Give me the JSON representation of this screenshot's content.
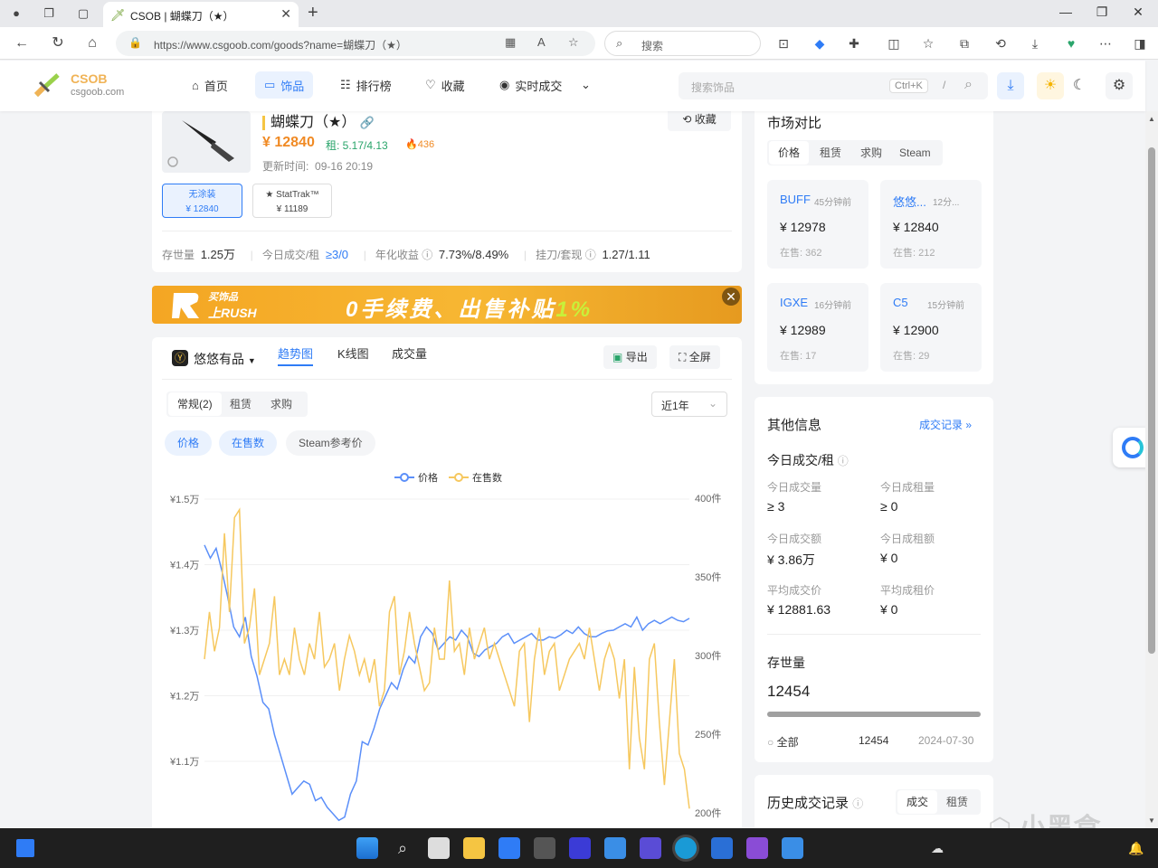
{
  "browser": {
    "tab_title": "CSOB | 蝴蝶刀（★）",
    "url": "https://www.csgoob.com/goods?name=蝴蝶刀（★）",
    "search_placeholder": "搜索"
  },
  "header": {
    "brand": "CSOB",
    "brand_sub": "csgoob.com",
    "nav": [
      {
        "label": "首页",
        "icon": "home-icon"
      },
      {
        "label": "饰品",
        "icon": "box-icon"
      },
      {
        "label": "排行榜",
        "icon": "ranking-icon"
      },
      {
        "label": "收藏",
        "icon": "heart-icon"
      },
      {
        "label": "实时成交",
        "icon": "live-icon"
      }
    ],
    "search_placeholder": "搜索饰品",
    "shortcut": "Ctrl+K",
    "slash": "/"
  },
  "item": {
    "title": "蝴蝶刀（★）",
    "price": "¥ 12840",
    "rent": "租: 5.17/4.13",
    "hot": "436",
    "updated_label": "更新时间:",
    "updated": "09-16 20:19",
    "fav": "收藏",
    "wear": [
      {
        "name": "无涂装",
        "price": "¥ 12840"
      },
      {
        "name": "★ StatTrak™",
        "price": "¥ 11189"
      }
    ],
    "stats": {
      "stock_label": "存世量",
      "stock": "1.25万",
      "today_label": "今日成交/租",
      "today": "≥3/0",
      "yield_label": "年化收益",
      "yield": "7.73%/8.49%",
      "ratio_label": "挂刀/套现",
      "ratio": "1.27/1.11"
    }
  },
  "banner": {
    "line1": "买饰品",
    "line2": "上RUSH",
    "main": "0手续费、出售补贴",
    "pct": "1%"
  },
  "chart_panel": {
    "platform": "悠悠有品",
    "tabs": [
      "趋势图",
      "K线图",
      "成交量"
    ],
    "export": "导出",
    "fullscreen": "全屏",
    "subtabs": [
      "常规(2)",
      "租赁",
      "求购"
    ],
    "range": "近1年",
    "filters": [
      "价格",
      "在售数",
      "Steam参考价"
    ]
  },
  "chart_data": {
    "type": "line",
    "legend": [
      "价格",
      "在售数"
    ],
    "legend_position": "top-center",
    "y_left_ticks": [
      "¥1.5万",
      "¥1.4万",
      "¥1.3万",
      "¥1.2万",
      "¥1.1万"
    ],
    "y_right_ticks": [
      "400件",
      "350件",
      "300件",
      "250件",
      "200件"
    ],
    "ylim_left": [
      10000,
      15000
    ],
    "ylim_right": [
      200,
      400
    ],
    "series": [
      {
        "name": "价格",
        "color": "#5b8ff9",
        "values": [
          14300,
          14100,
          14250,
          13900,
          13500,
          13050,
          12900,
          13200,
          12600,
          12300,
          11900,
          11800,
          11400,
          11100,
          10800,
          10500,
          10600,
          10700,
          10650,
          10400,
          10450,
          10300,
          10200,
          10100,
          10150,
          10500,
          10700,
          11300,
          11250,
          11500,
          11800,
          12000,
          12200,
          12100,
          12400,
          12600,
          12500,
          12900,
          13050,
          12950,
          12700,
          12800,
          12900,
          12850,
          13000,
          12900,
          12650,
          12600,
          12700,
          12750,
          12800,
          12900,
          12950,
          12800,
          12850,
          12900,
          12950,
          12850,
          12850,
          12900,
          12880,
          12930,
          13000,
          12950,
          13050,
          12950,
          12900,
          12900,
          12950,
          12990,
          13000,
          13050,
          13100,
          13050,
          13200,
          13000,
          13100,
          13150,
          13100,
          13150,
          13200,
          13150,
          13130,
          13180
        ]
      },
      {
        "name": "在售数",
        "color": "#f6c85f",
        "values": [
          300,
          330,
          305,
          320,
          380,
          330,
          390,
          395,
          310,
          320,
          345,
          290,
          300,
          310,
          340,
          290,
          300,
          290,
          320,
          300,
          290,
          310,
          300,
          330,
          295,
          300,
          310,
          280,
          300,
          315,
          305,
          290,
          300,
          285,
          300,
          270,
          280,
          330,
          340,
          290,
          305,
          330,
          310,
          295,
          280,
          285,
          320,
          300,
          300,
          350,
          305,
          310,
          290,
          320,
          300,
          310,
          320,
          300,
          310,
          300,
          290,
          280,
          270,
          305,
          310,
          260,
          300,
          320,
          290,
          305,
          310,
          280,
          290,
          300,
          305,
          310,
          300,
          320,
          300,
          280,
          300,
          310,
          300,
          275,
          300,
          230,
          295,
          250,
          230,
          300,
          310,
          260,
          220,
          260,
          300,
          240,
          230,
          205
        ]
      }
    ]
  },
  "market": {
    "title": "市场对比",
    "tabs": [
      "价格",
      "租赁",
      "求购",
      "Steam"
    ],
    "cards": [
      {
        "name": "BUFF",
        "time": "45分钟前",
        "price": "¥ 12978",
        "sale": "在售: 362"
      },
      {
        "name": "悠悠...",
        "time": "12分...",
        "price": "¥ 12840",
        "sale": "在售: 212"
      },
      {
        "name": "IGXE",
        "time": "16分钟前",
        "price": "¥ 12989",
        "sale": "在售: 17"
      },
      {
        "name": "C5",
        "time": "15分钟前",
        "price": "¥ 12900",
        "sale": "在售: 29"
      }
    ]
  },
  "other": {
    "title": "其他信息",
    "link": "成交记录 »",
    "today_title": "今日成交/租",
    "rows": [
      {
        "l1": "今日成交量",
        "v1": "≥ 3",
        "l2": "今日成租量",
        "v2": "≥ 0"
      },
      {
        "l1": "今日成交额",
        "v1": "¥ 3.86万",
        "l2": "今日成租额",
        "v2": "¥ 0"
      },
      {
        "l1": "平均成交价",
        "v1": "¥ 12881.63",
        "l2": "平均成租价",
        "v2": "¥ 0"
      }
    ],
    "stock_title": "存世量",
    "stock_value": "12454",
    "stock_row": {
      "label": "全部",
      "value": "12454",
      "date": "2024-07-30"
    },
    "stock_fill": 1.0
  },
  "history": {
    "title": "历史成交记录",
    "tabs": [
      "成交",
      "租赁"
    ]
  },
  "watermark": "小黑盒",
  "colors": {
    "accent": "#2f7cf6",
    "price": "#f08a24",
    "gold": "#f0b356"
  }
}
